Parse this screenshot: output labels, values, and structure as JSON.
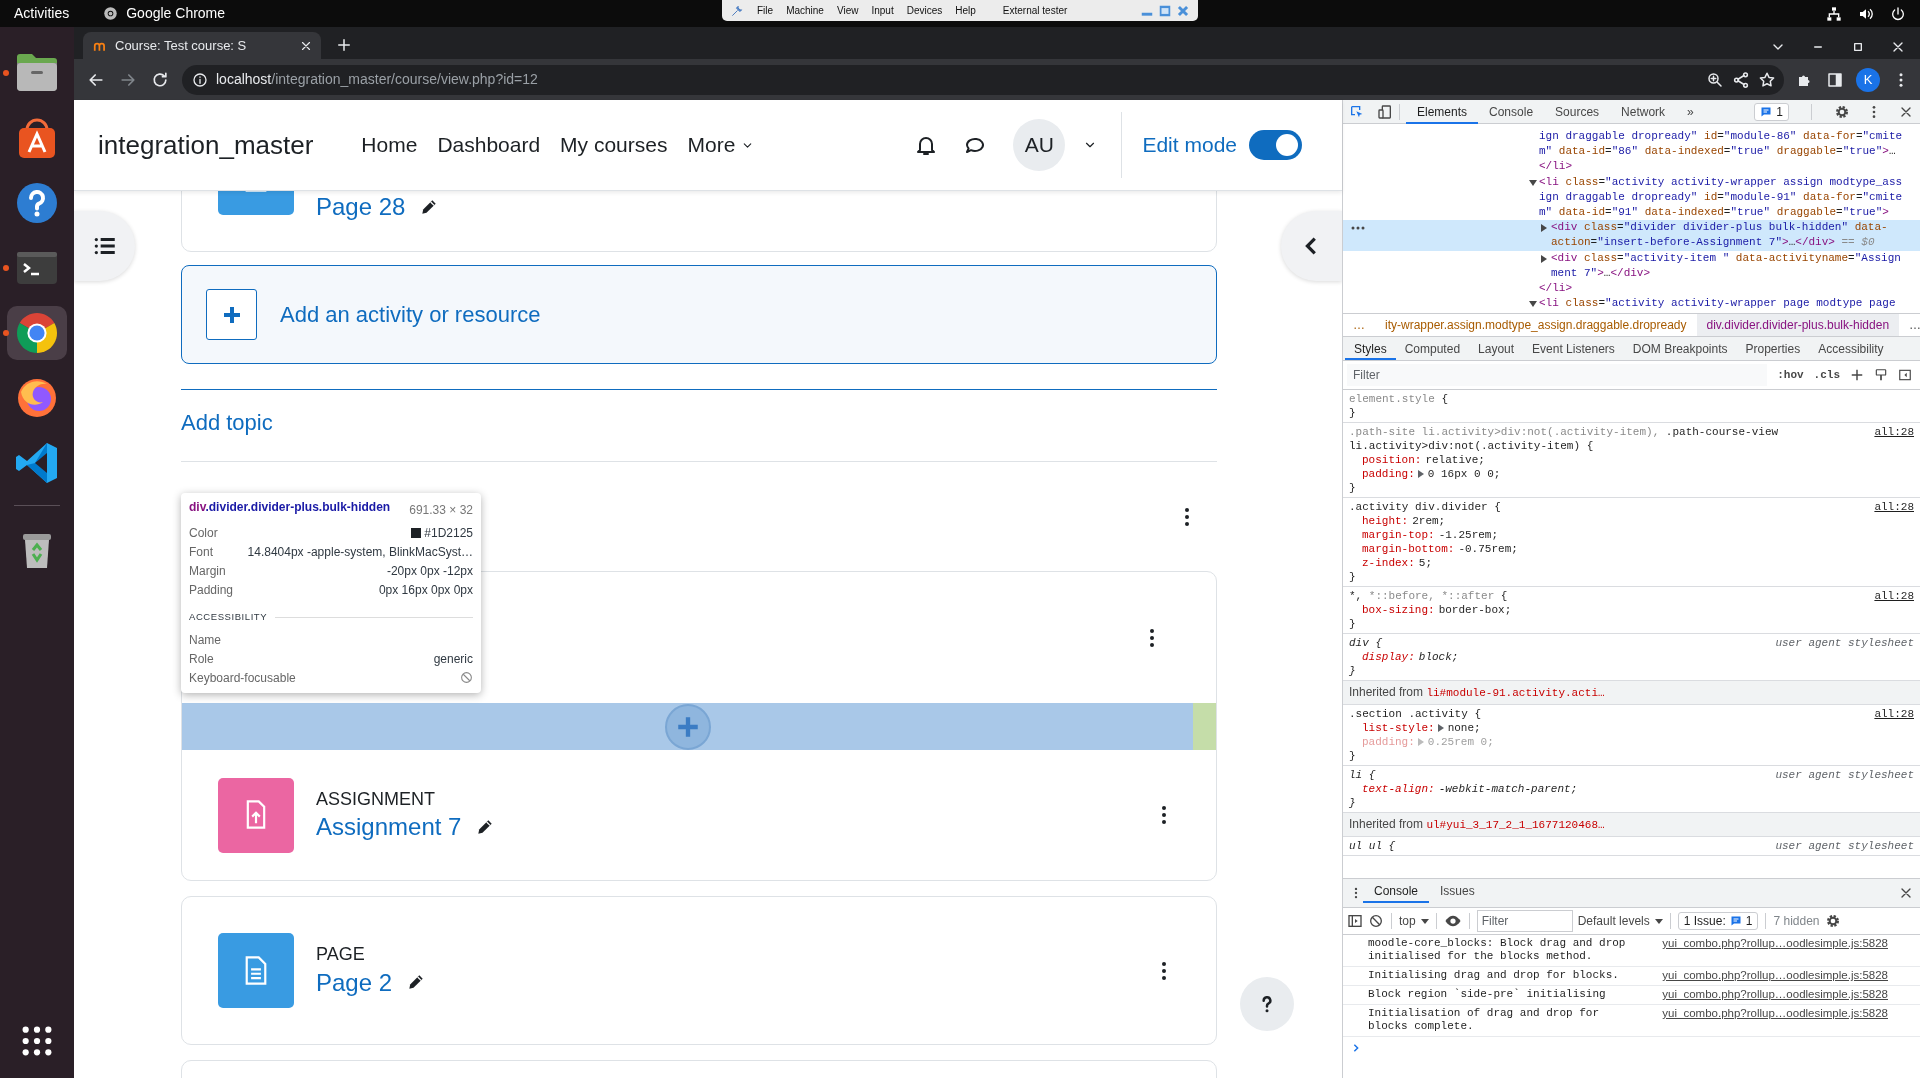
{
  "desktop": {
    "activities": "Activities",
    "app_name": "Google Chrome",
    "vm_menu": [
      "File",
      "Machine",
      "View",
      "Input",
      "Devices",
      "Help"
    ],
    "vm_label": "External tester"
  },
  "dock": [
    {
      "kind": "files",
      "running": true,
      "selected": false
    },
    {
      "kind": "store",
      "running": false,
      "selected": false
    },
    {
      "kind": "help",
      "running": false,
      "selected": false
    },
    {
      "kind": "terminal",
      "running": true,
      "selected": false
    },
    {
      "kind": "chrome",
      "running": true,
      "selected": true
    },
    {
      "kind": "firefox",
      "running": false,
      "selected": false
    },
    {
      "kind": "vscode",
      "running": false,
      "selected": false
    },
    {
      "kind": "trash",
      "running": false,
      "selected": false
    }
  ],
  "browser": {
    "tab_title": "Course: Test course: S",
    "url_host": "localhost",
    "url_path": "/integration_master/course/view.php?id=12",
    "profile": "K"
  },
  "site": {
    "brand": "integration_master",
    "nav": [
      {
        "label": "Home",
        "dropdown": false
      },
      {
        "label": "Dashboard",
        "dropdown": false
      },
      {
        "label": "My courses",
        "dropdown": false
      },
      {
        "label": "More",
        "dropdown": true
      }
    ],
    "avatar": "AU",
    "edit_mode": {
      "label": "Edit mode",
      "on": true
    }
  },
  "course": {
    "top_card": {
      "kind": "page",
      "name": "Page 28"
    },
    "add_activity": "Add an activity or resource",
    "add_topic": "Add topic",
    "section_activities": [
      {
        "kind": "assign",
        "type": "ASSIGNMENT",
        "name": "Assignment 7"
      }
    ],
    "page_cards": [
      {
        "kind": "page",
        "type": "PAGE",
        "name": "Page 2"
      }
    ]
  },
  "inspect_tooltip": {
    "tag": "div",
    "classes": ".divider.divider-plus.bulk-hidden",
    "size": "691.33 × 32",
    "rows": [
      {
        "label": "Color",
        "value": "#1D2125",
        "color": "#1d2125"
      },
      {
        "label": "Font",
        "value": "14.8404px -apple-system, BlinkMacSyst…"
      },
      {
        "label": "Margin",
        "value": "-20px 0px -12px"
      },
      {
        "label": "Padding",
        "value": "0px 16px 0px 0px"
      }
    ],
    "section": "ACCESSIBILITY",
    "a11y": [
      {
        "label": "Name"
      },
      {
        "label": "Role",
        "value": "generic"
      },
      {
        "label": "Keyboard-focusable",
        "focusable": false
      }
    ]
  },
  "devtools": {
    "tabs": [
      {
        "label": "Elements",
        "selected": true
      },
      {
        "label": "Console",
        "selected": false
      },
      {
        "label": "Sources",
        "selected": false
      },
      {
        "label": "Network",
        "selected": false
      }
    ],
    "more_tabs": "»",
    "issues_count": "1",
    "elements": [
      {
        "selected": false,
        "lines": [
          [
            {
              "kind": "value",
              "text": "ign draggable dropready\""
            },
            {
              "kind": "attr",
              "text": " id"
            },
            {
              "kind": "plain",
              "text": "="
            },
            {
              "kind": "value",
              "text": "\"module-86\""
            },
            {
              "kind": "attr",
              "text": " data-for"
            },
            {
              "kind": "plain",
              "text": "="
            },
            {
              "kind": "value",
              "text": "\"cmite"
            }
          ],
          [
            {
              "kind": "value",
              "text": "m\""
            },
            {
              "kind": "attr",
              "text": " data-id"
            },
            {
              "kind": "plain",
              "text": "="
            },
            {
              "kind": "value",
              "text": "\"86\""
            },
            {
              "kind": "attr",
              "text": " data-indexed"
            },
            {
              "kind": "plain",
              "text": "="
            },
            {
              "kind": "value",
              "text": "\"true\""
            },
            {
              "kind": "attr",
              "text": " draggable"
            },
            {
              "kind": "plain",
              "text": "="
            },
            {
              "kind": "value",
              "text": "\"true\""
            },
            {
              "kind": "tag",
              "text": ">"
            },
            {
              "kind": "plain",
              "text": "…"
            }
          ],
          [
            {
              "kind": "tag",
              "text": "</li>"
            }
          ]
        ]
      },
      {
        "selected": false,
        "expanded": true,
        "lines": [
          [
            {
              "kind": "tag",
              "text": "<li"
            },
            {
              "kind": "attr",
              "text": " class"
            },
            {
              "kind": "plain",
              "text": "="
            },
            {
              "kind": "value",
              "text": "\"activity activity-wrapper assign modtype_ass"
            }
          ],
          [
            {
              "kind": "value",
              "text": "ign draggable dropready\""
            },
            {
              "kind": "attr",
              "text": " id"
            },
            {
              "kind": "plain",
              "text": "="
            },
            {
              "kind": "value",
              "text": "\"module-91\""
            },
            {
              "kind": "attr",
              "text": " data-for"
            },
            {
              "kind": "plain",
              "text": "="
            },
            {
              "kind": "value",
              "text": "\"cmite"
            }
          ],
          [
            {
              "kind": "value",
              "text": "m\""
            },
            {
              "kind": "attr",
              "text": " data-id"
            },
            {
              "kind": "plain",
              "text": "="
            },
            {
              "kind": "value",
              "text": "\"91\""
            },
            {
              "kind": "attr",
              "text": " data-indexed"
            },
            {
              "kind": "plain",
              "text": "="
            },
            {
              "kind": "value",
              "text": "\"true\""
            },
            {
              "kind": "attr",
              "text": " draggable"
            },
            {
              "kind": "plain",
              "text": "="
            },
            {
              "kind": "value",
              "text": "\"true\""
            },
            {
              "kind": "tag",
              "text": ">"
            }
          ]
        ],
        "children": [
          {
            "selected": true,
            "expanded": false,
            "lines": [
              [
                {
                  "kind": "tag",
                  "text": "<div"
                },
                {
                  "kind": "attr",
                  "text": " class"
                },
                {
                  "kind": "plain",
                  "text": "="
                },
                {
                  "kind": "value",
                  "text": "\"divider divider-plus bulk-hidden\""
                },
                {
                  "kind": "attr",
                  "text": " data-"
                }
              ],
              [
                {
                  "kind": "attr",
                  "text": "action"
                },
                {
                  "kind": "plain",
                  "text": "="
                },
                {
                  "kind": "value",
                  "text": "\"insert-before-Assignment 7\""
                },
                {
                  "kind": "tag",
                  "text": ">"
                },
                {
                  "kind": "plain",
                  "text": "…"
                },
                {
                  "kind": "tag",
                  "text": "</div>"
                },
                {
                  "kind": "note",
                  "text": " == $0"
                }
              ]
            ]
          },
          {
            "selected": false,
            "expanded": false,
            "lines": [
              [
                {
                  "kind": "tag",
                  "text": "<div"
                },
                {
                  "kind": "attr",
                  "text": " class"
                },
                {
                  "kind": "plain",
                  "text": "="
                },
                {
                  "kind": "value",
                  "text": "\"activity-item \""
                },
                {
                  "kind": "attr",
                  "text": " data-activityname"
                },
                {
                  "kind": "plain",
                  "text": "="
                },
                {
                  "kind": "value",
                  "text": "\"Assign"
                }
              ],
              [
                {
                  "kind": "value",
                  "text": "ment 7\""
                },
                {
                  "kind": "tag",
                  "text": ">"
                },
                {
                  "kind": "plain",
                  "text": "…"
                },
                {
                  "kind": "tag",
                  "text": "</div>"
                }
              ]
            ]
          }
        ],
        "closing": [
          {
            "kind": "tag",
            "text": "</li>"
          }
        ]
      },
      {
        "selected": false,
        "expanded": true,
        "lines": [
          [
            {
              "kind": "tag",
              "text": "<li"
            },
            {
              "kind": "attr",
              "text": " class"
            },
            {
              "kind": "plain",
              "text": "="
            },
            {
              "kind": "value",
              "text": "\"activity activity-wrapper page modtype page"
            }
          ]
        ]
      }
    ],
    "breadcrumbs": {
      "leading": "…",
      "items": [
        {
          "text": "ity-wrapper.assign.modtype_assign.draggable.dropready",
          "selected": false
        },
        {
          "text": "div.divider.divider-plus.bulk-hidden",
          "selected": true
        }
      ],
      "trailing": "…"
    },
    "style_tabs": [
      {
        "label": "Styles",
        "selected": true
      },
      {
        "label": "Computed",
        "selected": false
      },
      {
        "label": "Layout",
        "selected": false
      },
      {
        "label": "Event Listeners",
        "selected": false
      },
      {
        "label": "DOM Breakpoints",
        "selected": false
      },
      {
        "label": "Properties",
        "selected": false
      },
      {
        "label": "Accessibility",
        "selected": false
      }
    ],
    "filter": {
      "placeholder": "Filter"
    },
    "hov": ":hov",
    "cls": ".cls",
    "rules": [
      {
        "kind": "rule",
        "user_agent": false,
        "selector": [
          {
            "text": "element.style",
            "matched": false
          }
        ],
        "open": " {",
        "close": "}"
      },
      {
        "kind": "rule",
        "user_agent": false,
        "source": "all:28",
        "selector": [
          {
            "text": ".path-site li.activity>div:not(.activity-item), ",
            "matched": false
          },
          {
            "text": ".path-course-view li.activity>div:not(.activity-item)",
            "matched": true
          }
        ],
        "open": " {",
        "declarations": [
          {
            "name": "position:",
            "value": "relative;",
            "expandable": false,
            "inactive": false
          },
          {
            "name": "padding:",
            "value": "0 16px 0 0;",
            "expandable": true,
            "inactive": false
          }
        ],
        "close": "}"
      },
      {
        "kind": "rule",
        "user_agent": false,
        "source": "all:28",
        "selector": [
          {
            "text": ".activity div.divider",
            "matched": true
          }
        ],
        "open": " {",
        "declarations": [
          {
            "name": "height:",
            "value": "2rem;",
            "expandable": false,
            "inactive": false
          },
          {
            "name": "margin-top:",
            "value": "-1.25rem;",
            "expandable": false,
            "inactive": false
          },
          {
            "name": "margin-bottom:",
            "value": "-0.75rem;",
            "expandable": false,
            "inactive": false
          },
          {
            "name": "z-index:",
            "value": "5;",
            "expandable": false,
            "inactive": false
          }
        ],
        "close": "}"
      },
      {
        "kind": "rule",
        "user_agent": false,
        "source": "all:28",
        "selector": [
          {
            "text": "*, ",
            "matched": true
          },
          {
            "text": "*::before, *::after",
            "matched": false
          }
        ],
        "open": " {",
        "declarations": [
          {
            "name": "box-sizing:",
            "value": "border-box;",
            "expandable": false,
            "inactive": false
          }
        ],
        "close": "}"
      },
      {
        "kind": "rule",
        "user_agent": true,
        "source": "user agent stylesheet",
        "selector": [
          {
            "text": "div",
            "matched": true
          }
        ],
        "open": " {",
        "declarations": [
          {
            "name": "display:",
            "value": "block;",
            "expandable": false,
            "inactive": false
          }
        ],
        "close": "}"
      },
      {
        "kind": "inherited",
        "label": "Inherited from",
        "target": "li#module-91.activity.acti…"
      },
      {
        "kind": "rule",
        "user_agent": false,
        "source": "all:28",
        "selector": [
          {
            "text": ".section .activity",
            "matched": true
          }
        ],
        "open": " {",
        "declarations": [
          {
            "name": "list-style:",
            "value": "none;",
            "expandable": true,
            "inactive": false
          },
          {
            "name": "padding:",
            "value": "0.25rem 0;",
            "expandable": true,
            "inactive": true
          }
        ],
        "close": "}"
      },
      {
        "kind": "rule",
        "user_agent": true,
        "source": "user agent stylesheet",
        "selector": [
          {
            "text": "li",
            "matched": true
          }
        ],
        "open": " {",
        "declarations": [
          {
            "name": "text-align:",
            "value": "-webkit-match-parent;",
            "expandable": false,
            "inactive": false
          }
        ],
        "close": "}"
      },
      {
        "kind": "inherited",
        "label": "Inherited from",
        "target": "ul#yui_3_17_2_1_1677120468…"
      },
      {
        "kind": "rule",
        "user_agent": true,
        "source": "user agent stylesheet",
        "selector": [
          {
            "text": "ul ul",
            "matched": true
          }
        ],
        "open": " {"
      }
    ]
  },
  "console": {
    "tabs": [
      {
        "label": "Console",
        "selected": true
      },
      {
        "label": "Issues",
        "selected": false
      }
    ],
    "context": "top",
    "filter": {
      "placeholder": "Filter"
    },
    "levels": "Default levels",
    "issues_label": "1 Issue:",
    "issues_count": "1",
    "hidden": "7 hidden",
    "messages": [
      {
        "text": "moodle-core_blocks: Block drag and drop initialised for the blocks method.",
        "source": "yui_combo.php?rollup…oodlesimple.js:5828"
      },
      {
        "text": "Initialising drag and drop for blocks.",
        "source": "yui_combo.php?rollup…oodlesimple.js:5828"
      },
      {
        "text": "Block region `side-pre` initialising",
        "source": "yui_combo.php?rollup…oodlesimple.js:5828"
      },
      {
        "text": "Initialisation of drag and drop for blocks complete.",
        "source": "yui_combo.php?rollup…oodlesimple.js:5828"
      }
    ]
  }
}
